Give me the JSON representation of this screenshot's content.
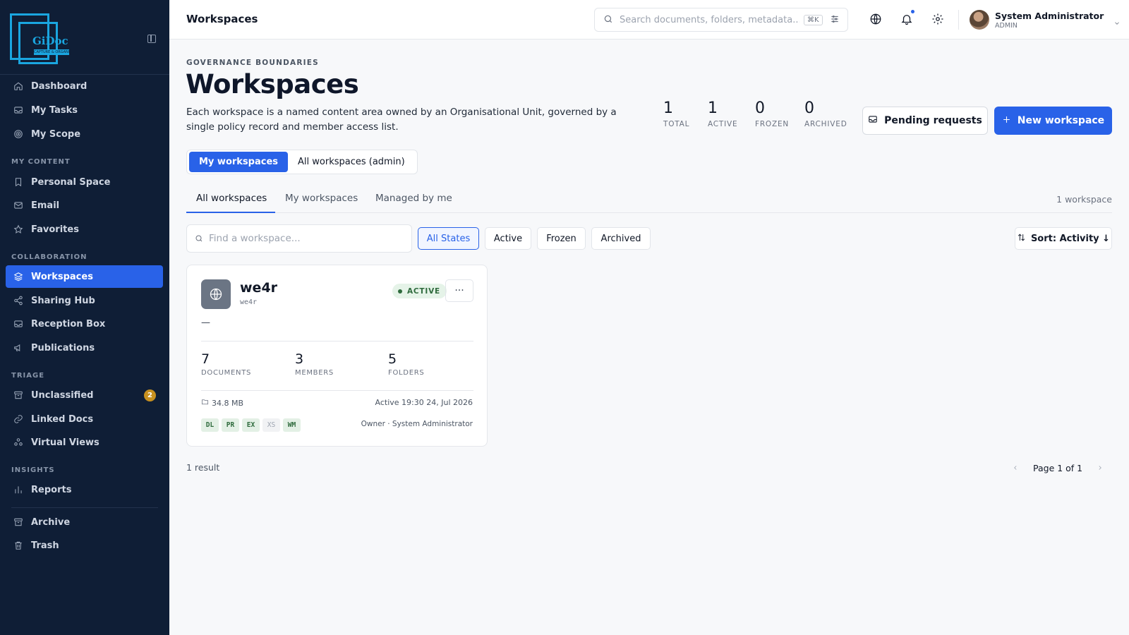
{
  "brand": {
    "name": "GiDoc",
    "tagline": "CAPTURE & ORGANISE"
  },
  "sidebar": {
    "top": [
      {
        "label": "Dashboard",
        "icon": "home-icon"
      },
      {
        "label": "My Tasks",
        "icon": "inbox-icon"
      },
      {
        "label": "My Scope",
        "icon": "target-icon"
      }
    ],
    "sections": {
      "my_content": "MY CONTENT",
      "collaboration": "COLLABORATION",
      "triage": "TRIAGE",
      "insights": "INSIGHTS"
    },
    "my_content": [
      {
        "label": "Personal Space",
        "icon": "bookmark-icon"
      },
      {
        "label": "Email",
        "icon": "mail-icon"
      },
      {
        "label": "Favorites",
        "icon": "star-icon"
      }
    ],
    "collaboration": [
      {
        "label": "Workspaces",
        "icon": "layers-icon",
        "active": true
      },
      {
        "label": "Sharing Hub",
        "icon": "share-icon"
      },
      {
        "label": "Reception Box",
        "icon": "inbox-icon"
      },
      {
        "label": "Publications",
        "icon": "megaphone-icon"
      }
    ],
    "triage": [
      {
        "label": "Unclassified",
        "icon": "archive-box-icon",
        "badge": "2"
      },
      {
        "label": "Linked Docs",
        "icon": "link-icon"
      },
      {
        "label": "Virtual Views",
        "icon": "cluster-icon"
      }
    ],
    "insights": [
      {
        "label": "Reports",
        "icon": "bar-chart-icon"
      }
    ],
    "bottom": [
      {
        "label": "Archive",
        "icon": "archive-box-icon"
      },
      {
        "label": "Trash",
        "icon": "trash-icon"
      }
    ]
  },
  "header": {
    "title": "Workspaces",
    "search_placeholder": "Search documents, folders, metadata...",
    "search_shortcut": "⌘K",
    "user_name": "System Administrator",
    "user_role": "ADMIN"
  },
  "page": {
    "eyebrow": "GOVERNANCE BOUNDARIES",
    "title": "Workspaces",
    "description": "Each workspace is a named content area owned by an Organisational Unit, governed by a single policy record and member access list.",
    "stats": [
      {
        "value": "1",
        "label": "TOTAL"
      },
      {
        "value": "1",
        "label": "ACTIVE"
      },
      {
        "value": "0",
        "label": "FROZEN"
      },
      {
        "value": "0",
        "label": "ARCHIVED"
      }
    ],
    "pending_label": "Pending requests",
    "new_label": "New workspace",
    "scope_toggle": [
      "My workspaces",
      "All workspaces (admin)"
    ],
    "tabs": [
      "All workspaces",
      "My workspaces",
      "Managed by me"
    ],
    "count_label": "1 workspace",
    "find_placeholder": "Find a workspace...",
    "state_filters": [
      "All States",
      "Active",
      "Frozen",
      "Archived"
    ],
    "sort_label": "Sort: Activity ↓",
    "result_label": "1 result",
    "page_label": "Page 1 of 1"
  },
  "workspace": {
    "name": "we4r",
    "code": "we4r",
    "status": "ACTIVE",
    "description": "—",
    "metrics": [
      {
        "value": "7",
        "label": "DOCUMENTS"
      },
      {
        "value": "3",
        "label": "MEMBERS"
      },
      {
        "value": "5",
        "label": "FOLDERS"
      }
    ],
    "size": "34.8 MB",
    "activity": "Active 19:30 24, Jul 2026",
    "permissions": [
      {
        "code": "DL",
        "enabled": true
      },
      {
        "code": "PR",
        "enabled": true
      },
      {
        "code": "EX",
        "enabled": true
      },
      {
        "code": "XS",
        "enabled": false
      },
      {
        "code": "WM",
        "enabled": true
      }
    ],
    "owner": "Owner · System Administrator"
  },
  "colors": {
    "sidebar_bg": "#0f1e36",
    "accent": "#2962e8",
    "active_status": "#2f6b3d",
    "badge": "#c7901f"
  }
}
